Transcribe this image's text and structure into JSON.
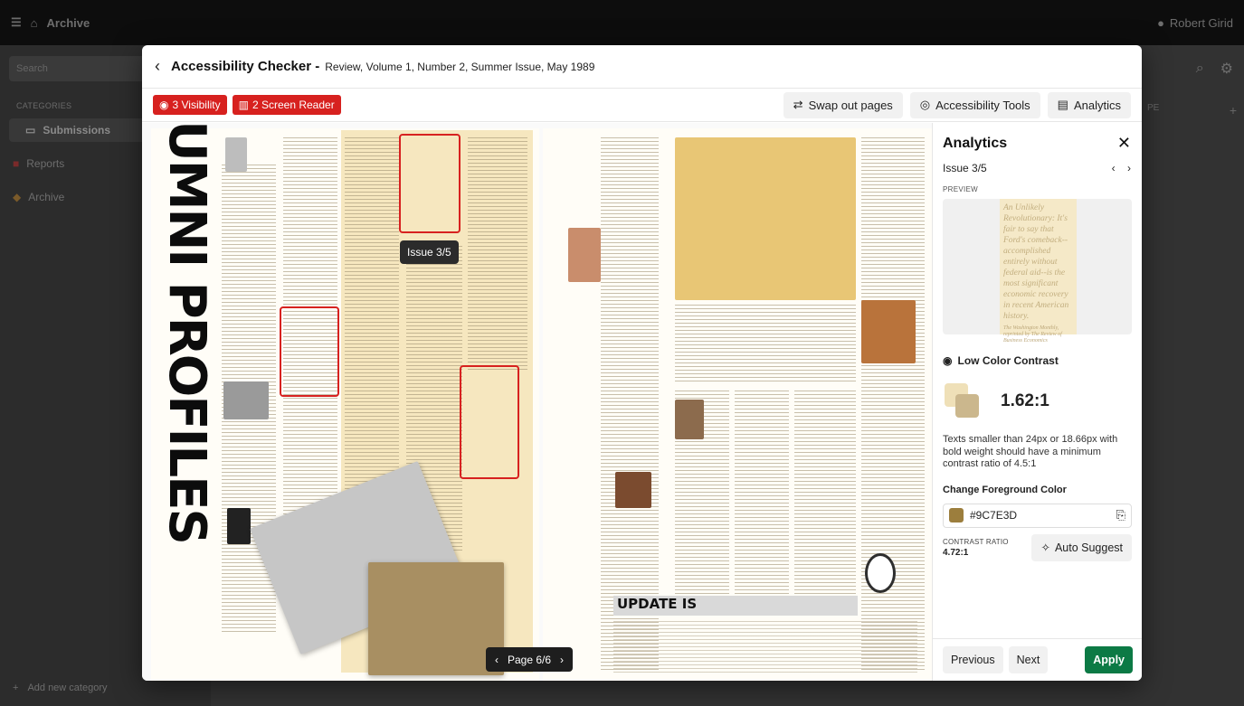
{
  "background": {
    "app_name": "Archive",
    "user_name": "Robert Girid",
    "search_placeholder": "Search",
    "categories_label": "CATEGORIES",
    "nav": [
      {
        "label": "Submissions"
      },
      {
        "label": "Reports"
      },
      {
        "label": "Archive"
      }
    ],
    "add_category": "Add new category",
    "right_tab_label": "PE"
  },
  "modal": {
    "title": "Accessibility Checker -",
    "subtitle": "Review, Volume 1, Number 2, Summer Issue, May 1989",
    "chips": {
      "visibility": "3 Visibility",
      "screen_reader": "2 Screen Reader"
    },
    "toolbar": {
      "swap": "Swap out pages",
      "tools": "Accessibility Tools",
      "analytics": "Analytics"
    },
    "document": {
      "vertical_title": "ALUMNI PROFILES",
      "tooltip": "Issue 3/5",
      "page_indicator": "Page 6/6",
      "update_heading": "UPDATE IS"
    }
  },
  "panel": {
    "title": "Analytics",
    "issue": "Issue 3/5",
    "preview_label": "PREVIEW",
    "preview_text": "An Unlikely Revolutionary: It's fair to say that Ford's comeback--accomplished entirely without federal aid--is the most significant economic recovery in recent American history.",
    "preview_caption": "The Washington Monthly, reprinted by The Review of Business Economics",
    "issue_type": "Low Color Contrast",
    "ratio": "1.62:1",
    "description": "Texts smaller than 24px or 18.66px with bold weight should have a minimum contrast ratio of 4.5:1",
    "fg_label": "Change Foreground Color",
    "fg_value": "#9C7E3D",
    "contrast_label": "CONTRAST RATIO",
    "contrast_value": "4.72:1",
    "auto_suggest": "Auto Suggest",
    "previous": "Previous",
    "next": "Next",
    "apply": "Apply"
  },
  "colors": {
    "accent_red": "#d7211f",
    "apply_green": "#0c7a45",
    "swatch_back": "#efe0b8",
    "swatch_front": "#cbb78d",
    "foreground": "#9C7E3D"
  }
}
